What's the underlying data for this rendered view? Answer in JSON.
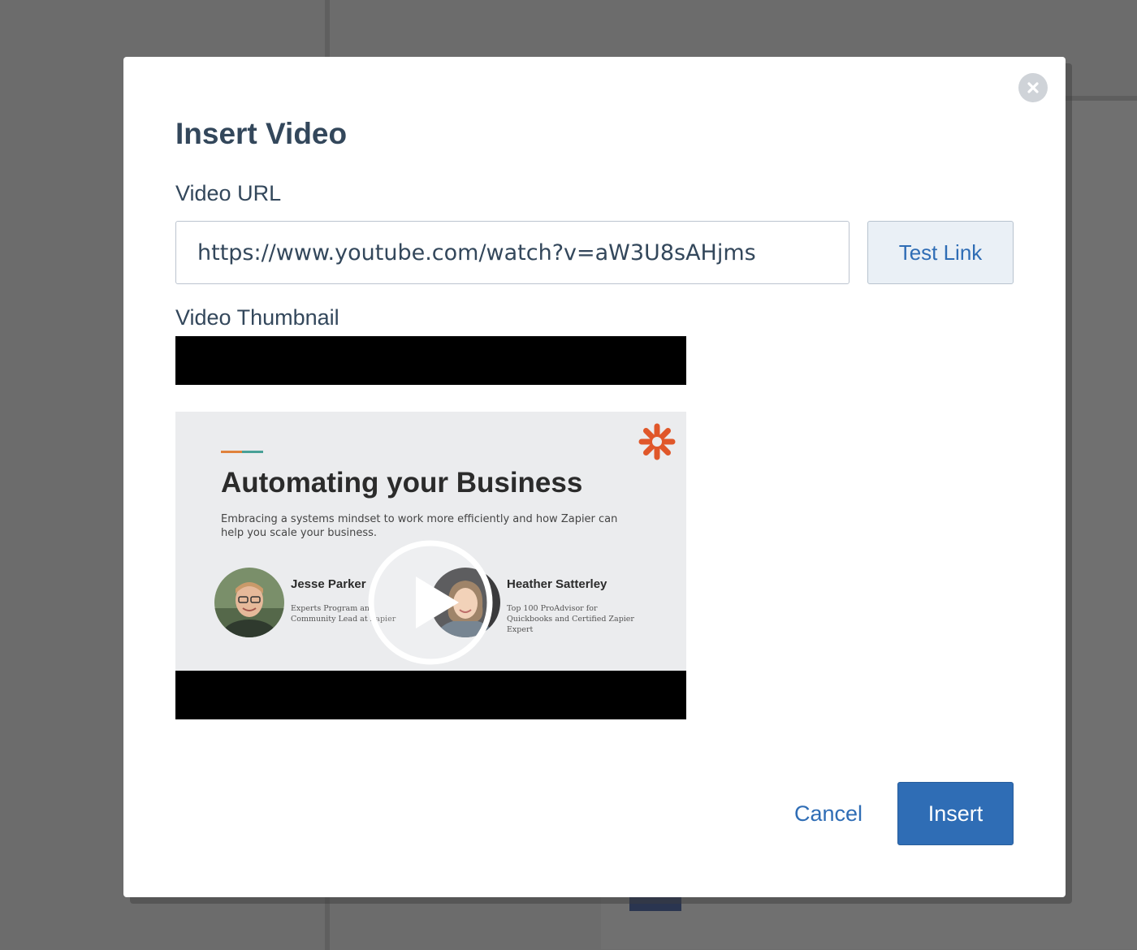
{
  "dialog": {
    "title": "Insert Video",
    "close_icon": "close-icon"
  },
  "video_url": {
    "label": "Video URL",
    "value": "https://www.youtube.com/watch?v=aW3U8sAHjms",
    "test_button_label": "Test Link"
  },
  "thumbnail": {
    "label": "Video Thumbnail",
    "slide": {
      "title": "Automating your Business",
      "subtitle": "Embracing a systems mindset to work more efficiently and how Zapier can help you scale your business.",
      "brand_icon": "zapier-asterisk-icon",
      "brand_color": "#e0572a",
      "presenters": [
        {
          "name": "Jesse Parker",
          "role": "Experts Program and Community Lead at Zapier"
        },
        {
          "name": "Heather Satterley",
          "role": "Top 100 ProAdvisor for Quickbooks and Certified Zapier Expert"
        }
      ],
      "play_icon": "play-icon"
    }
  },
  "footer": {
    "cancel_label": "Cancel",
    "insert_label": "Insert"
  },
  "colors": {
    "primary": "#2f6db5",
    "text": "#33475b",
    "overlay": "#6c6c6c"
  }
}
